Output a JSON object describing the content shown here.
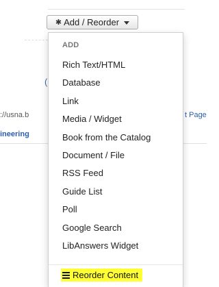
{
  "button": {
    "label": "Add / Reorder",
    "icon": "gear-icon"
  },
  "background": {
    "url_fragment": "://usna.b",
    "page_link_fragment": "t Page",
    "engineering_fragment": "ineering",
    "blue_fragment": "("
  },
  "menu": {
    "header": "ADD",
    "items": [
      "Rich Text/HTML",
      "Database",
      "Link",
      "Media / Widget",
      "Book from the Catalog",
      "Document / File",
      "RSS Feed",
      "Guide List",
      "Poll",
      "Google Search",
      "LibAnswers Widget"
    ],
    "reorder_label": "Reorder Content",
    "reorder_icon": "bars-icon",
    "highlight_color": "#ffff33"
  }
}
